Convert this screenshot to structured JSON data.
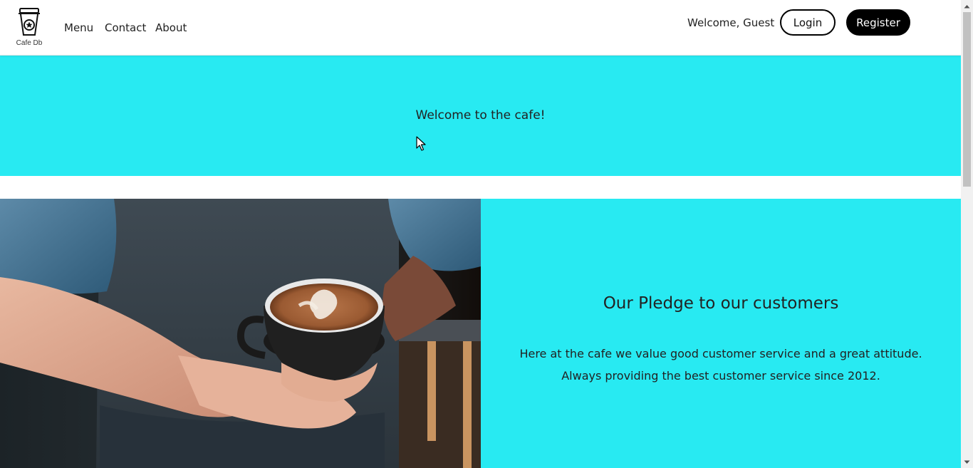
{
  "logo": {
    "text": "Cafe Db",
    "icon": "coffee-cup-star-icon"
  },
  "nav": {
    "menu": "Menu",
    "contact": "Contact",
    "about": "About"
  },
  "user": {
    "welcome": "Welcome, Guest",
    "login_label": "Login",
    "register_label": "Register"
  },
  "hero": {
    "text": "Welcome to the cafe!",
    "background": "#28eaf2"
  },
  "pledge": {
    "title": "Our Pledge to our customers",
    "line1": "Here at the cafe we value good customer service and a great attitude.",
    "line2": "Always providing the best customer service since 2012.",
    "image": "barista-holding-latte-photo",
    "background": "#28eaf2"
  },
  "colors": {
    "accent": "#28eaf2",
    "button_dark": "#000000",
    "text": "#222222"
  }
}
